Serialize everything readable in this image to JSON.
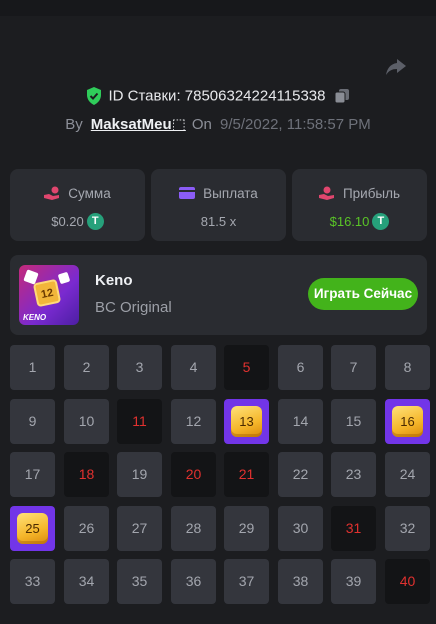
{
  "bet": {
    "id_label": "ID Ставки:",
    "id_value": "78506324224115338",
    "by_label": "By",
    "username": "MaksatMeu⬚",
    "on_label": "On",
    "datetime": "9/5/2022, 11:58:57 PM"
  },
  "stats": {
    "amount": {
      "label": "Сумма",
      "value": "$0.20",
      "currency_icon": "usdt-icon",
      "icon": "coins-hand-icon",
      "icon_color": "#e0466e"
    },
    "payout": {
      "label": "Выплата",
      "value": "81.5 x",
      "icon": "wallet-icon",
      "icon_color": "#8b5cf6"
    },
    "profit": {
      "label": "Прибыль",
      "value": "$16.10",
      "currency_icon": "usdt-icon",
      "icon": "profit-hand-icon",
      "icon_color": "#e0466e",
      "value_color": "#5ac427"
    }
  },
  "game": {
    "thumbnail_text": "KENO",
    "thumbnail_tile": "12",
    "name": "Keno",
    "subtitle": "BC Original",
    "play_label": "Играть Сейчас"
  },
  "board": {
    "columns": 8,
    "numbers": [
      "1",
      "2",
      "3",
      "4",
      "5",
      "6",
      "7",
      "8",
      "9",
      "10",
      "11",
      "12",
      "13",
      "14",
      "15",
      "16",
      "17",
      "18",
      "19",
      "20",
      "21",
      "22",
      "23",
      "24",
      "25",
      "26",
      "27",
      "28",
      "29",
      "30",
      "31",
      "32",
      "33",
      "34",
      "35",
      "36",
      "37",
      "38",
      "39",
      "40"
    ],
    "drawn": [
      "5",
      "11",
      "18",
      "20",
      "21",
      "31",
      "40"
    ],
    "hits": [
      "13",
      "16",
      "25"
    ]
  },
  "colors": {
    "accent_green": "#43b31b",
    "drawn_text": "#e0312f",
    "hit_bg": "#7235e8",
    "verified_green": "#2fcc5a"
  }
}
